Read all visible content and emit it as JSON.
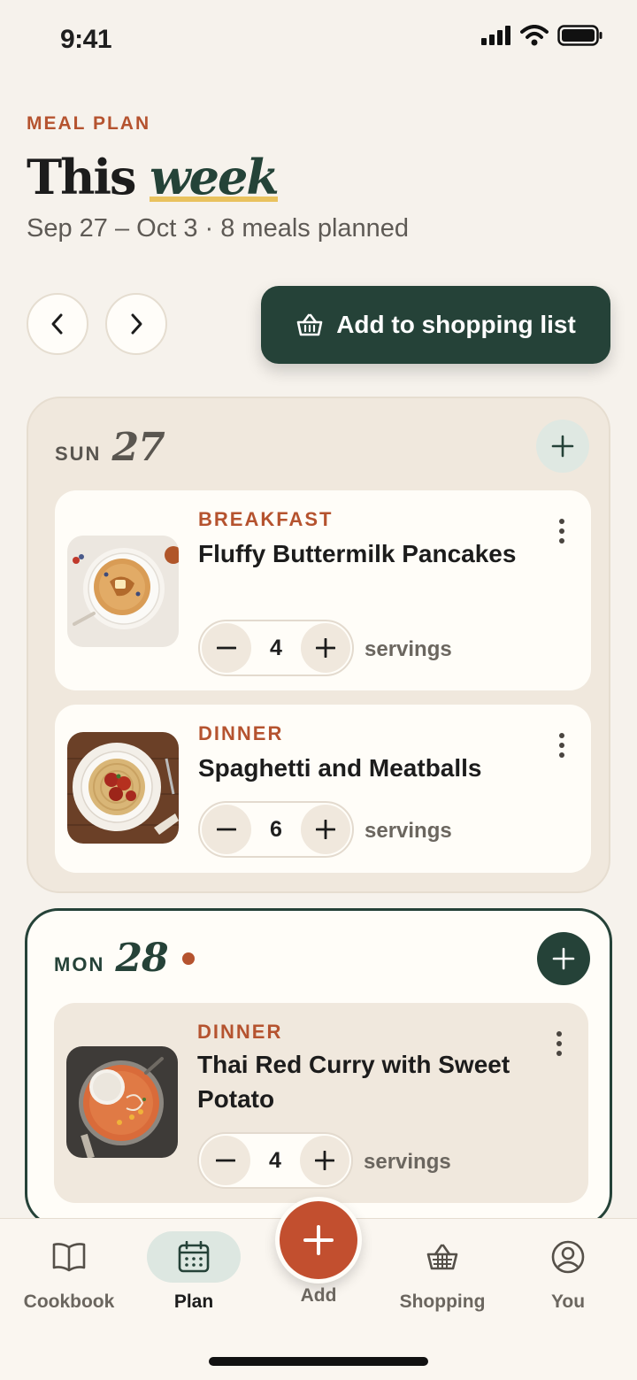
{
  "status": {
    "time": "9:41"
  },
  "header": {
    "eyebrow": "MEAL PLAN",
    "title_main": "This",
    "title_accent": "week",
    "subtitle": "Sep 27 – Oct 3 · 8 meals planned"
  },
  "actions": {
    "shopping_label": "Add to shopping list"
  },
  "days": [
    {
      "dow": "SUN",
      "num": "27",
      "meals": [
        {
          "type": "BREAKFAST",
          "name": "Fluffy Buttermilk Pancakes",
          "servings": "4",
          "servings_label": "servings",
          "image": "pancakes"
        },
        {
          "type": "DINNER",
          "name": "Spaghetti and Meatballs",
          "servings": "6",
          "servings_label": "servings",
          "image": "spaghetti"
        }
      ]
    },
    {
      "dow": "MON",
      "num": "28",
      "today": true,
      "meals": [
        {
          "type": "DINNER",
          "name": "Thai Red Curry with Sweet Potato",
          "servings": "4",
          "servings_label": "servings",
          "image": "curry"
        }
      ]
    }
  ],
  "tabs": [
    {
      "label": "Cookbook",
      "icon": "book-icon"
    },
    {
      "label": "Plan",
      "icon": "calendar-icon",
      "active": true
    },
    {
      "label": "Add",
      "icon": "plus-icon"
    },
    {
      "label": "Shopping",
      "icon": "basket-icon"
    },
    {
      "label": "You",
      "icon": "user-icon"
    }
  ],
  "colors": {
    "accent": "#b5532f",
    "primary": "#254238",
    "background": "#f6f2ec",
    "highlight": "#e9c25e"
  }
}
